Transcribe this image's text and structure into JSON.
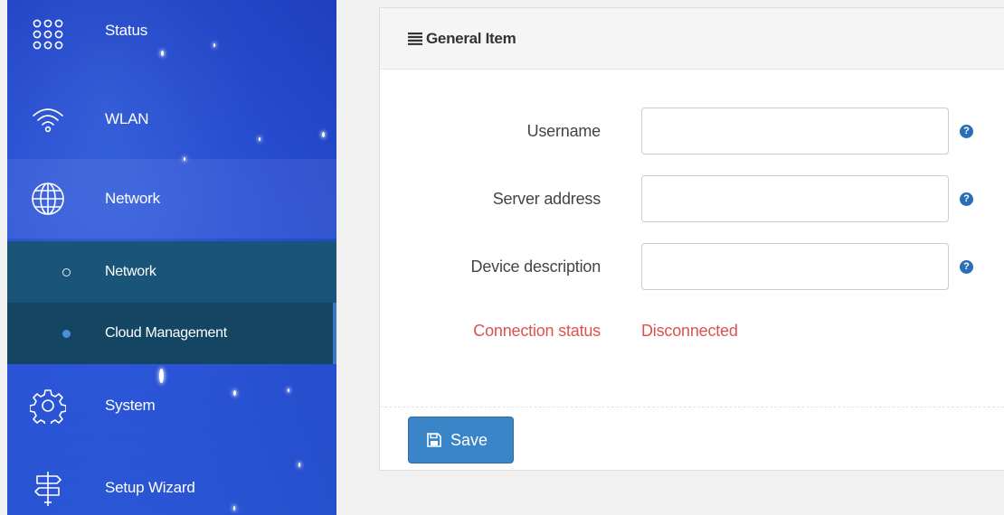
{
  "sidebar": {
    "items": [
      {
        "label": "Status",
        "icon": "dots-grid-icon"
      },
      {
        "label": "WLAN",
        "icon": "wifi-icon"
      },
      {
        "label": "Network",
        "icon": "globe-icon"
      },
      {
        "label": "System",
        "icon": "gear-icon"
      },
      {
        "label": "Setup Wizard",
        "icon": "signpost-icon"
      }
    ],
    "subitems": [
      {
        "label": "Network"
      },
      {
        "label": "Cloud Management"
      }
    ]
  },
  "panel": {
    "title": "General Item",
    "fields": [
      {
        "label": "Username",
        "value": "",
        "placeholder": ""
      },
      {
        "label": "Server address",
        "value": "",
        "placeholder": ""
      },
      {
        "label": "Device description",
        "value": "",
        "placeholder": ""
      }
    ],
    "help_glyph": "?",
    "status_label": "Connection status",
    "status_value": "Disconnected",
    "save_label": "Save"
  },
  "colors": {
    "sidebar_blue": "#2950d4",
    "submenu_teal": "#1a5478",
    "submenu_selected": "#144663",
    "primary_button": "#3a84c8",
    "danger_text": "#d9534f",
    "help_icon": "#2a6fb5"
  }
}
